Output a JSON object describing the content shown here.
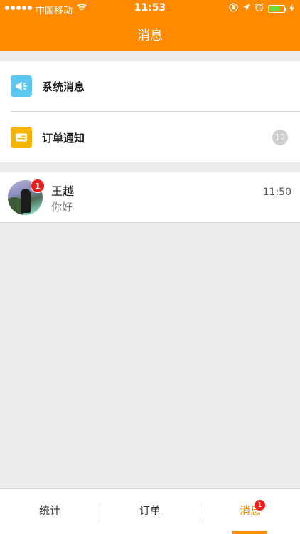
{
  "status_bar": {
    "carrier": "中国移动",
    "time": "11:53",
    "battery_level": 0.7
  },
  "nav": {
    "title": "消息"
  },
  "system_items": [
    {
      "label": "系统消息",
      "icon": "speaker-icon",
      "icon_color": "#5ac8f0"
    },
    {
      "label": "订单通知",
      "icon": "envelope-icon",
      "icon_color": "#f5b400",
      "count": "12"
    }
  ],
  "conversations": [
    {
      "name": "王越",
      "preview": "你好",
      "time": "11:50",
      "unread": "1"
    }
  ],
  "tabbar": {
    "tabs": [
      {
        "label": "统计"
      },
      {
        "label": "订单"
      },
      {
        "label": "消息",
        "badge": "1"
      }
    ],
    "active_color": "#ff8a00"
  },
  "colors": {
    "accent": "#ff8a00",
    "badge": "#ee1c1c",
    "background": "#ececec"
  }
}
